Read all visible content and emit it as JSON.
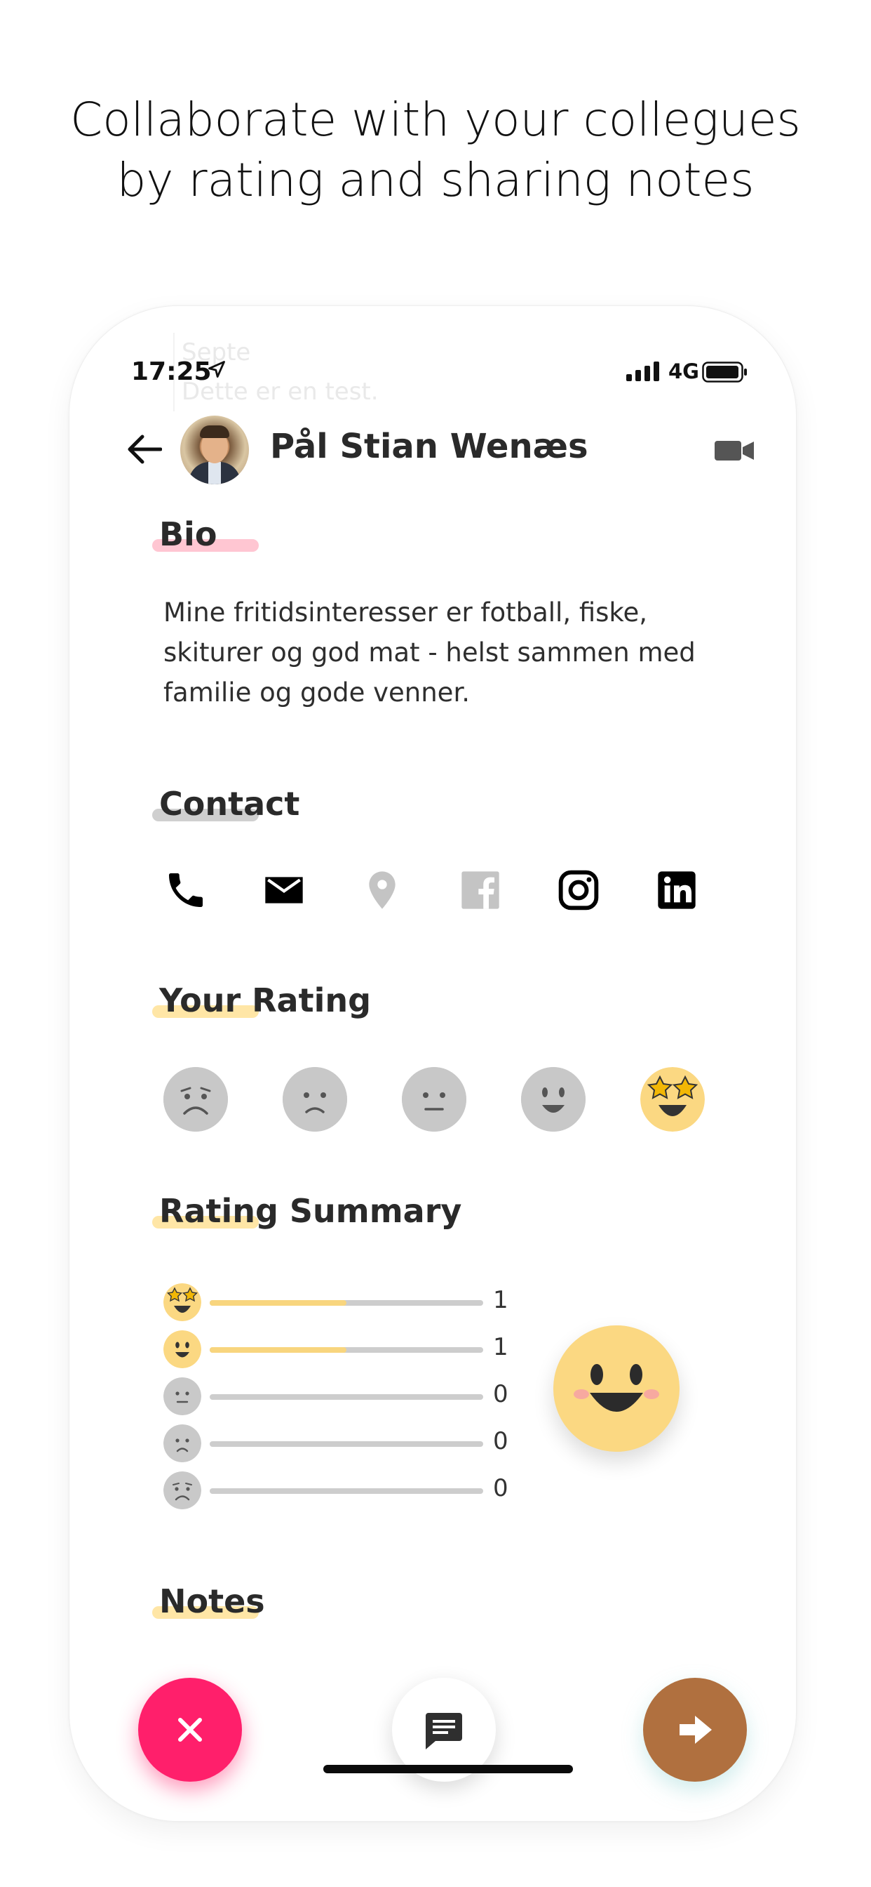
{
  "headline": {
    "line1": "Collaborate with your collegues",
    "line2": "by rating and sharing notes"
  },
  "status_bar": {
    "time": "17:25",
    "network": "4G",
    "icons": [
      "location-arrow-icon",
      "signal-bars-icon",
      "battery-icon"
    ]
  },
  "ghost_card": {
    "title": "Septe",
    "text": "Dette er en test."
  },
  "header": {
    "name": "Pål Stian Wenæs",
    "icons": [
      "back-arrow-icon",
      "video-camera-icon"
    ]
  },
  "bio": {
    "title": "Bio",
    "text": "Mine fritidsinteresser er fotball, fiske, skiturer og god mat - helst sammen med familie og gode venner.",
    "highlight_color": "#ffc6d2"
  },
  "contact": {
    "title": "Contact",
    "highlight_color": "#cfcfcf",
    "items": [
      {
        "icon": "phone-icon",
        "active": true
      },
      {
        "icon": "mail-icon",
        "active": true
      },
      {
        "icon": "location-pin-icon",
        "active": false
      },
      {
        "icon": "facebook-icon",
        "active": false
      },
      {
        "icon": "instagram-icon",
        "active": true
      },
      {
        "icon": "linkedin-icon",
        "active": true
      }
    ]
  },
  "your_rating": {
    "title": "Your Rating",
    "highlight_color": "#ffe6a6",
    "options": [
      "very-sad-face-icon",
      "sad-face-icon",
      "neutral-face-icon",
      "smile-face-icon",
      "star-eyes-face-icon"
    ],
    "selected_index": 4
  },
  "rating_summary": {
    "title": "Rating Summary",
    "highlight_color": "#ffe6a6",
    "rows": [
      {
        "icon": "star-eyes-face-icon",
        "count": "1",
        "fraction": 0.5
      },
      {
        "icon": "smile-face-icon",
        "count": "1",
        "fraction": 0.5
      },
      {
        "icon": "neutral-face-icon",
        "count": "0",
        "fraction": 0
      },
      {
        "icon": "sad-face-icon",
        "count": "0",
        "fraction": 0
      },
      {
        "icon": "very-sad-face-icon",
        "count": "0",
        "fraction": 0
      }
    ],
    "overall_icon": "big-smile-face-icon"
  },
  "notes": {
    "title": "Notes",
    "highlight_color": "#ffe6a6"
  },
  "actions": {
    "close_icon": "close-icon",
    "chat_icon": "chat-icon",
    "next_icon": "arrow-right-icon"
  },
  "colors": {
    "accent_pink": "#ff1f6b",
    "accent_brown": "#b0703f",
    "rating_yellow": "#f8d57e",
    "face_gray": "#c8c8c8"
  }
}
